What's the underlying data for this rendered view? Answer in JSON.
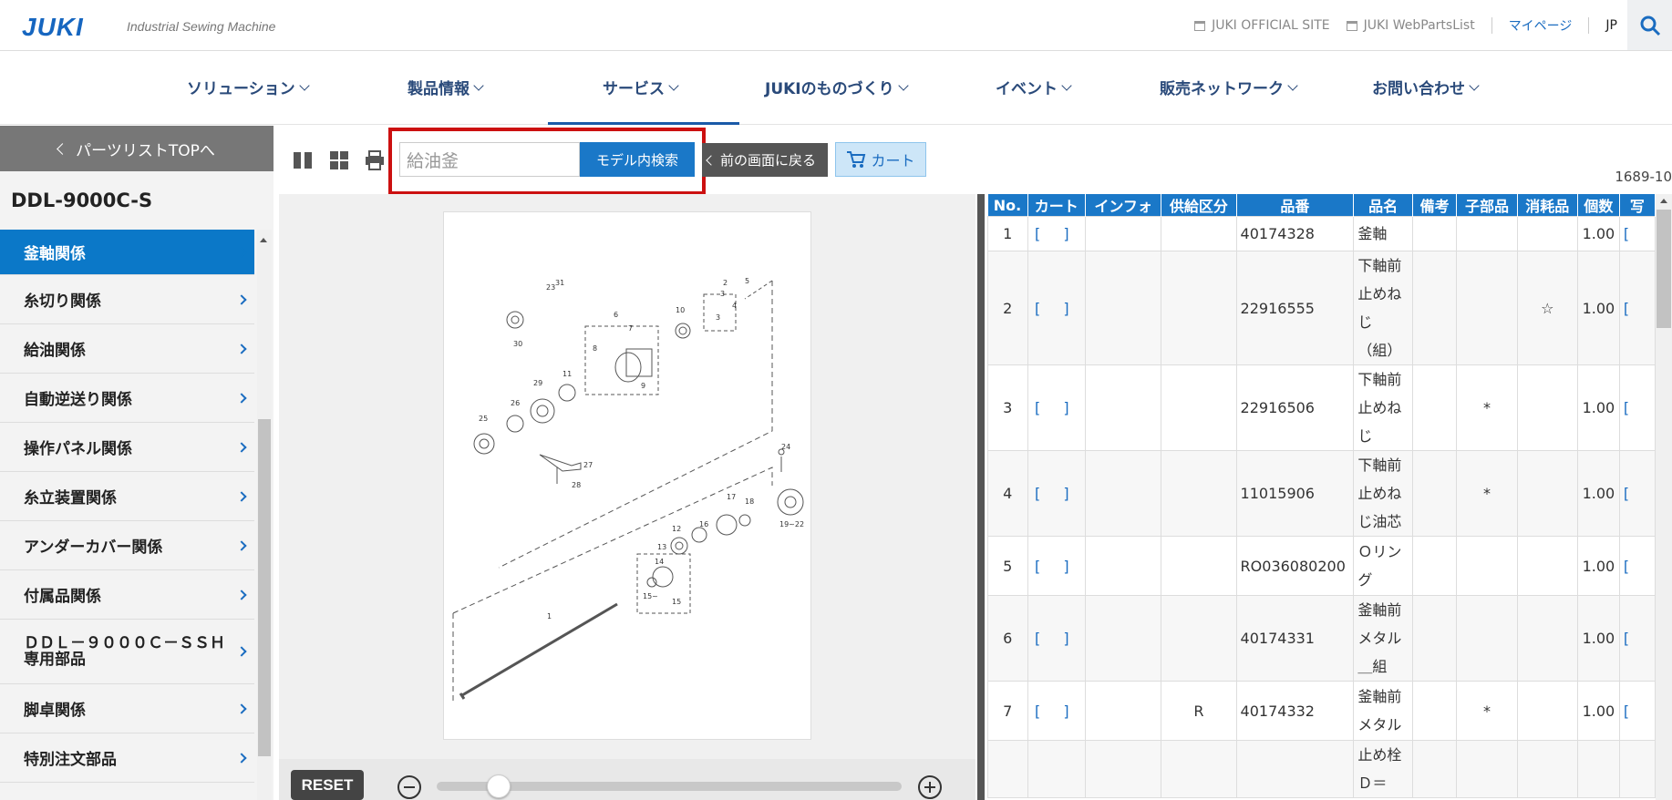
{
  "header": {
    "logo": "JUKI",
    "logo_sub": "Industrial Sewing Machine",
    "links": [
      "JUKI OFFICIAL SITE",
      "JUKI WebPartsList"
    ],
    "mypage": "マイページ",
    "lang": "JP"
  },
  "nav": {
    "items": [
      "ソリューション",
      "製品情報",
      "サービス",
      "JUKIのものづくり",
      "イベント",
      "販売ネットワーク",
      "お問い合わせ"
    ],
    "active": "サービス"
  },
  "sidebar": {
    "back_label": "パーツリストTOPへ",
    "model": "DDL-9000C-S",
    "categories": [
      "釜軸関係",
      "糸切り関係",
      "給油関係",
      "自動逆送り関係",
      "操作パネル関係",
      "糸立装置関係",
      "アンダーカバー関係",
      "付属品関係",
      "ＤＤＬ－９０００Ｃ－ＳＳＨ専用部品",
      "脚卓関係",
      "特別注文部品"
    ],
    "active_index": 0
  },
  "toolbar": {
    "search_value": "給油釜",
    "search_button": "モデル内検索",
    "back_button": "前の画面に戻る",
    "cart_button": "カート",
    "page_no": "1689-10"
  },
  "viewer": {
    "reset": "RESET",
    "zoom_level": 0.15
  },
  "table": {
    "headers": [
      "No.",
      "カート",
      "インフォ",
      "供給区分",
      "品番",
      "品名",
      "備考",
      "子部品",
      "消耗品",
      "個数",
      "写"
    ],
    "rows": [
      {
        "no": "1",
        "cart": "[ ]",
        "info": "",
        "supply": "",
        "part": "40174328",
        "name": "釜軸",
        "note": "",
        "child": "",
        "consumable": "",
        "qty": "1.00",
        "photo": "["
      },
      {
        "no": "2",
        "cart": "[ ]",
        "info": "",
        "supply": "",
        "part": "22916555",
        "name": "下軸前止めねじ（組）",
        "note": "",
        "child": "",
        "consumable": "☆",
        "qty": "1.00",
        "photo": "["
      },
      {
        "no": "3",
        "cart": "[ ]",
        "info": "",
        "supply": "",
        "part": "22916506",
        "name": "下軸前止めねじ",
        "note": "",
        "child": "*",
        "consumable": "",
        "qty": "1.00",
        "photo": "["
      },
      {
        "no": "4",
        "cart": "[ ]",
        "info": "",
        "supply": "",
        "part": "11015906",
        "name": "下軸前止めねじ油芯",
        "note": "",
        "child": "*",
        "consumable": "",
        "qty": "1.00",
        "photo": "["
      },
      {
        "no": "5",
        "cart": "[ ]",
        "info": "",
        "supply": "",
        "part": "RO036080200",
        "name": "Ｏリング",
        "note": "",
        "child": "",
        "consumable": "",
        "qty": "1.00",
        "photo": "["
      },
      {
        "no": "6",
        "cart": "[ ]",
        "info": "",
        "supply": "",
        "part": "40174331",
        "name": "釜軸前メタル＿組",
        "note": "",
        "child": "",
        "consumable": "",
        "qty": "1.00",
        "photo": "["
      },
      {
        "no": "7",
        "cart": "[ ]",
        "info": "",
        "supply": "R",
        "part": "40174332",
        "name": "釜軸前メタル",
        "note": "",
        "child": "*",
        "consumable": "",
        "qty": "1.00",
        "photo": "["
      },
      {
        "no": "",
        "cart": "",
        "info": "",
        "supply": "",
        "part": "",
        "name": "止め栓Ｄ＝",
        "note": "",
        "child": "",
        "consumable": "",
        "qty": "",
        "photo": ""
      }
    ]
  },
  "diagram_labels": [
    "1",
    "2",
    "3",
    "4",
    "5",
    "6",
    "7",
    "8",
    "9",
    "10",
    "11",
    "12",
    "13",
    "14",
    "15",
    "15",
    "16",
    "17",
    "18",
    "19~22",
    "23",
    "24",
    "25",
    "26",
    "27",
    "28",
    "29",
    "30",
    "31",
    "15~"
  ]
}
